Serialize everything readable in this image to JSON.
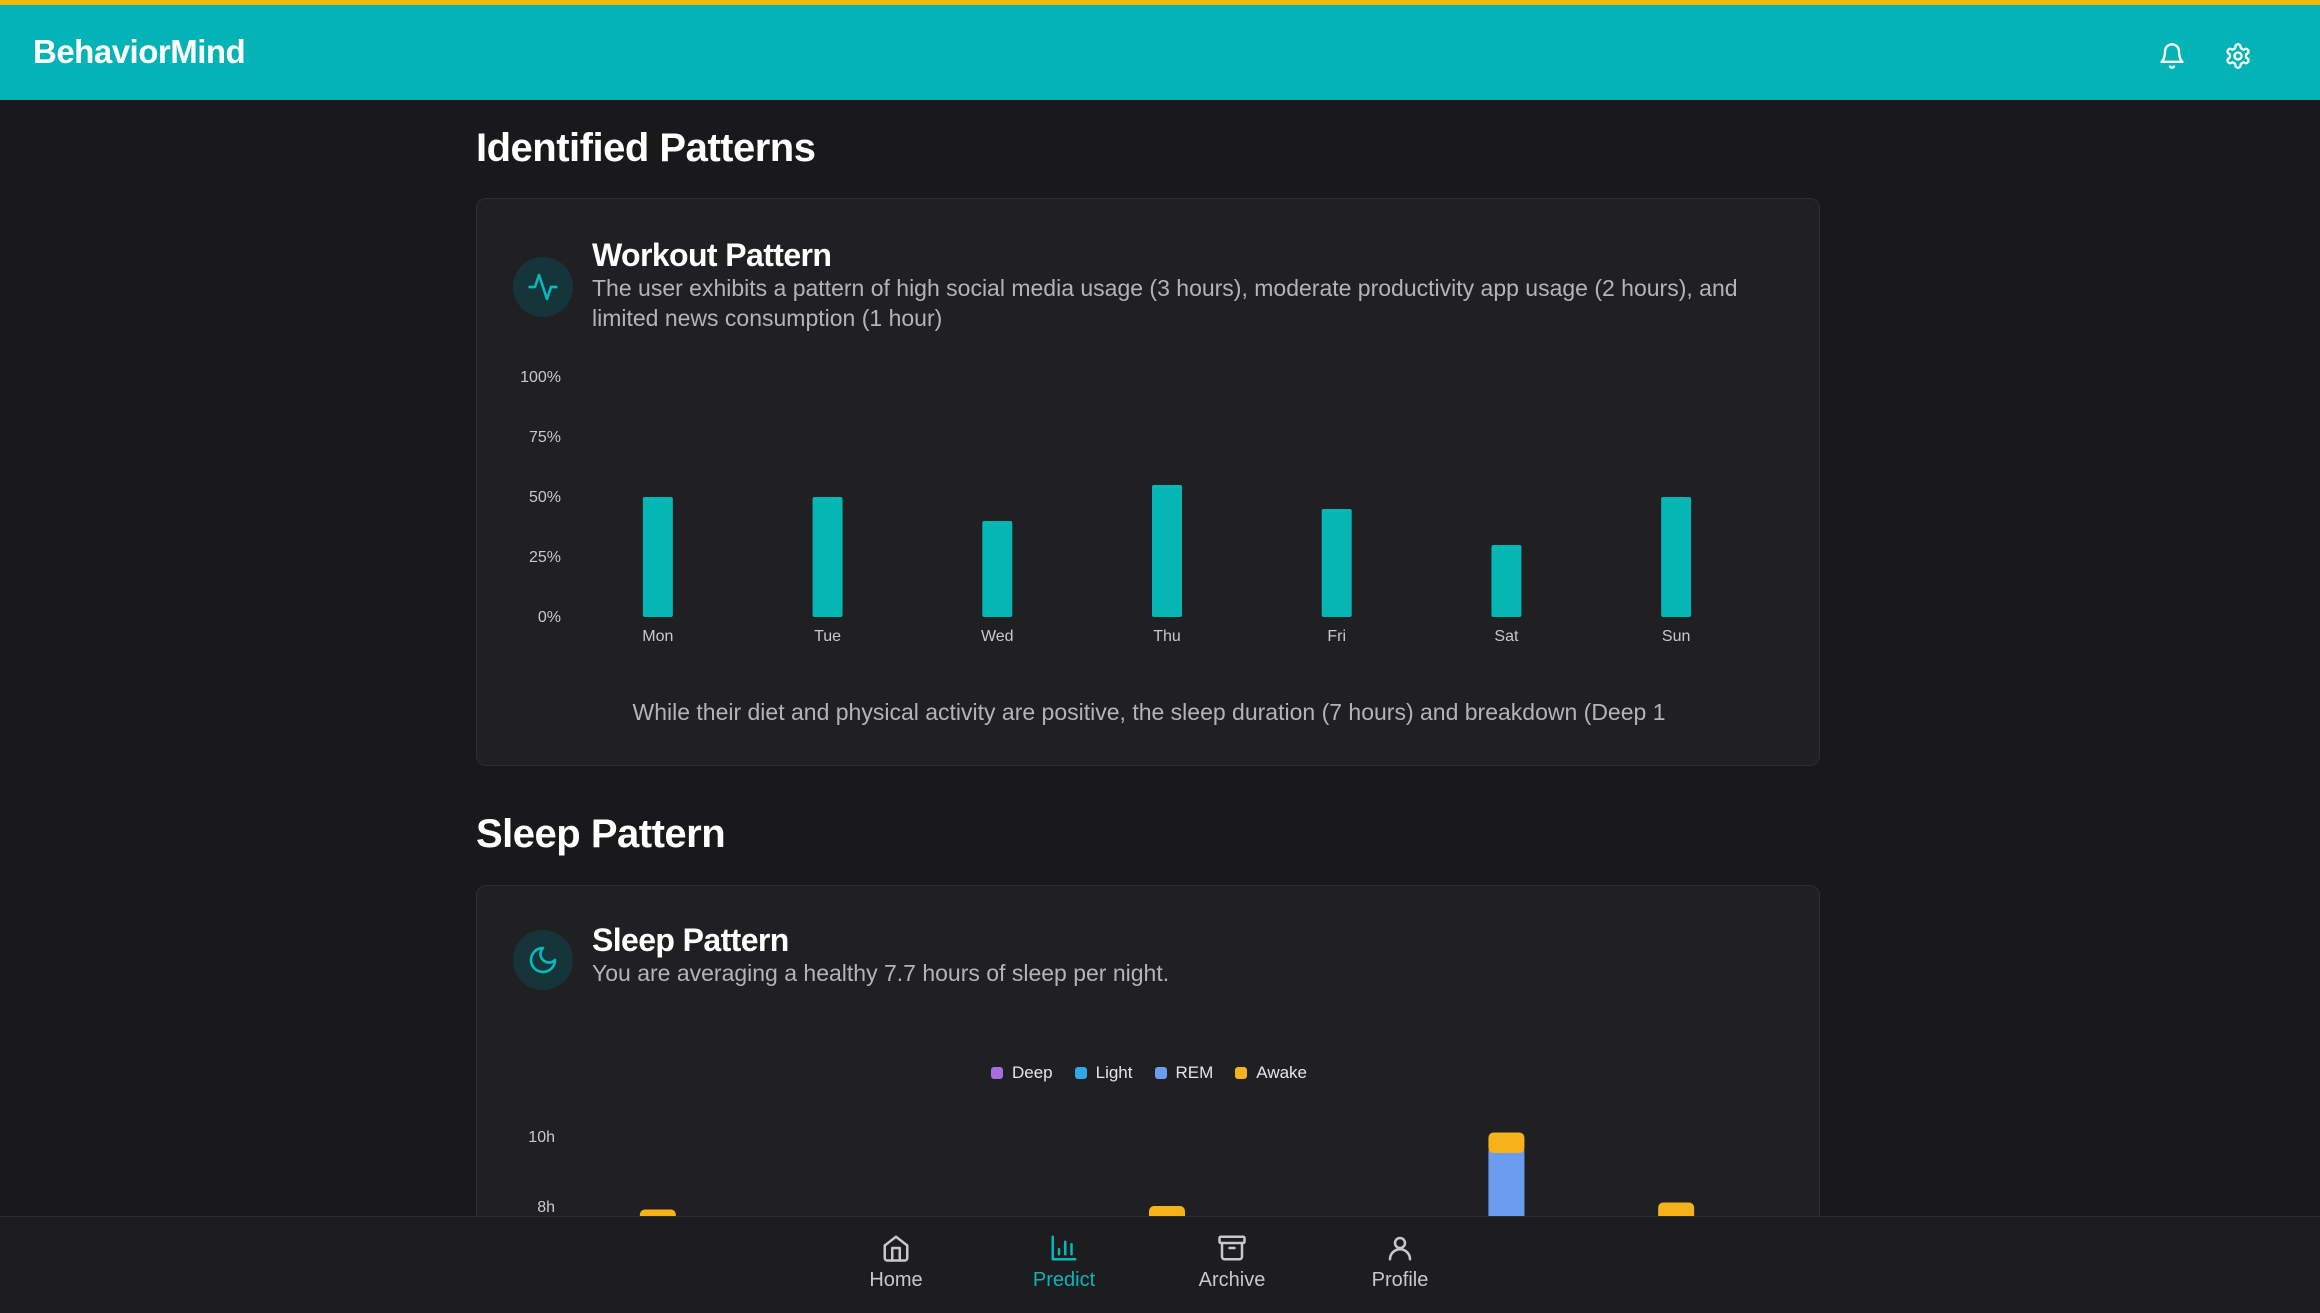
{
  "app": {
    "title": "BehaviorMind"
  },
  "header": {
    "icons": [
      "bell-icon",
      "gear-icon"
    ]
  },
  "colors": {
    "accent": "#03b3b5",
    "accent_border": "#f0b90b",
    "bar": "#06b6b4"
  },
  "sections": {
    "patterns_title": "Identified Patterns",
    "sleep_title": "Sleep Pattern"
  },
  "workout": {
    "title": "Workout Pattern",
    "description": "The user exhibits a pattern of high social media usage (3 hours), moderate productivity app usage (2 hours), and limited news consumption (1 hour)",
    "note": "While their diet and physical activity are positive, the sleep duration (7 hours) and breakdown (Deep 1",
    "icon": "activity-icon"
  },
  "sleep": {
    "title": "Sleep Pattern",
    "description": "You are averaging a healthy 7.7 hours of sleep per night.",
    "icon": "moon-icon"
  },
  "chart_data": [
    {
      "type": "bar",
      "categories": [
        "Mon",
        "Tue",
        "Wed",
        "Thu",
        "Fri",
        "Sat",
        "Sun"
      ],
      "values": [
        50,
        50,
        40,
        55,
        45,
        30,
        50
      ],
      "yticks": [
        "0%",
        "25%",
        "50%",
        "75%",
        "100%"
      ],
      "ylim": [
        0,
        100
      ],
      "grid": false
    },
    {
      "type": "bar",
      "stacked": true,
      "legend": [
        "Deep",
        "Light",
        "REM",
        "Awake"
      ],
      "legend_colors": [
        "#a66ee0",
        "#2ea8e8",
        "#6b9cf0",
        "#f5b21b"
      ],
      "yticks_visible": [
        "10h",
        "8h"
      ],
      "visible_segments": [
        {
          "index": 0,
          "awake_top": 7.9
        },
        {
          "index": 3,
          "awake_top": 8.0
        },
        {
          "index": 5,
          "rem_top": 9.6,
          "awake_top": 10.1
        },
        {
          "index": 6,
          "awake_top": 8.1
        }
      ]
    }
  ],
  "nav": {
    "items": [
      {
        "label": "Home",
        "icon": "home-icon",
        "active": false
      },
      {
        "label": "Predict",
        "icon": "bar-chart-icon",
        "active": true
      },
      {
        "label": "Archive",
        "icon": "archive-icon",
        "active": false
      },
      {
        "label": "Profile",
        "icon": "user-icon",
        "active": false
      }
    ]
  }
}
